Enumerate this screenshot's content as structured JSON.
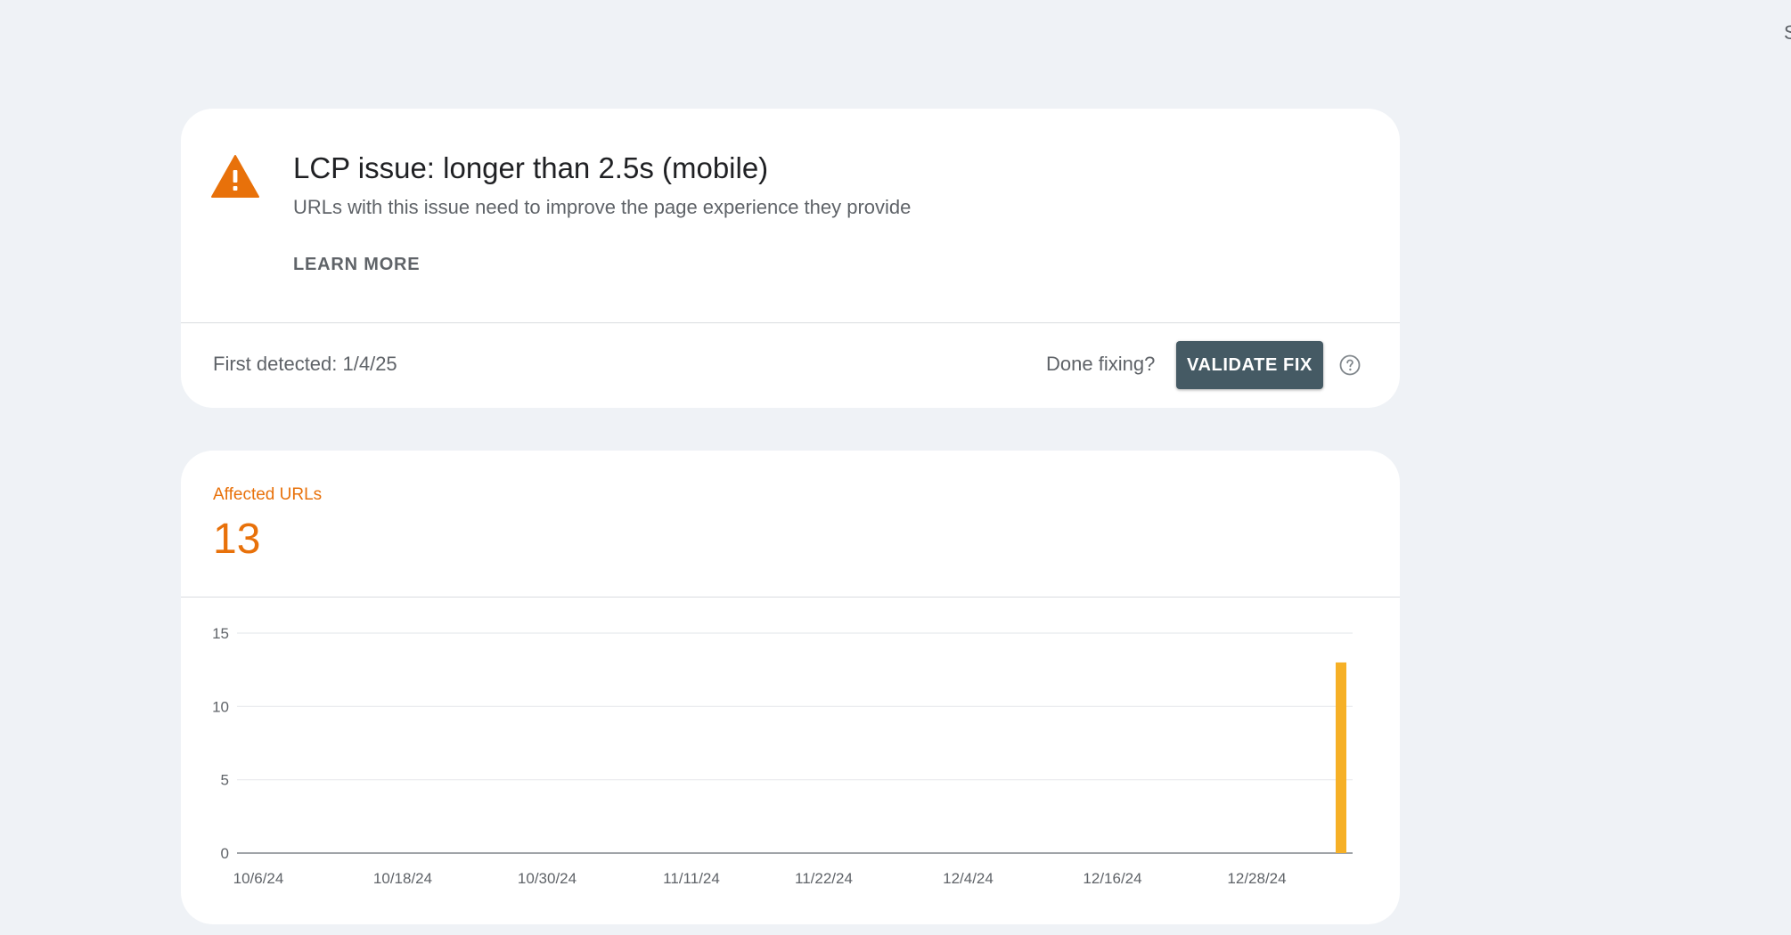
{
  "edge_text": "S",
  "issue": {
    "title": "LCP issue: longer than 2.5s (mobile)",
    "subtitle": "URLs with this issue need to improve the page experience they provide",
    "learn_more": "LEARN MORE",
    "first_detected": "First detected: 1/4/25",
    "done_fixing": "Done fixing?",
    "validate_button": "VALIDATE FIX",
    "warning_icon": "warning-triangle-icon",
    "help_icon": "help-circle-icon",
    "warning_color": "#e8710a"
  },
  "metric": {
    "label": "Affected URLs",
    "value": "13",
    "color": "#e8710a"
  },
  "chart_data": {
    "type": "bar",
    "x_tick_labels": [
      "10/6/24",
      "10/18/24",
      "10/30/24",
      "11/11/24",
      "11/22/24",
      "12/4/24",
      "12/16/24",
      "12/28/24"
    ],
    "y_ticks": [
      0,
      5,
      10,
      15
    ],
    "ylim": [
      0,
      15
    ],
    "grid": true,
    "bar_color": "#f6b026",
    "series": [
      {
        "values": [
          {
            "x": "1/4/25",
            "y": 13
          }
        ]
      }
    ]
  }
}
